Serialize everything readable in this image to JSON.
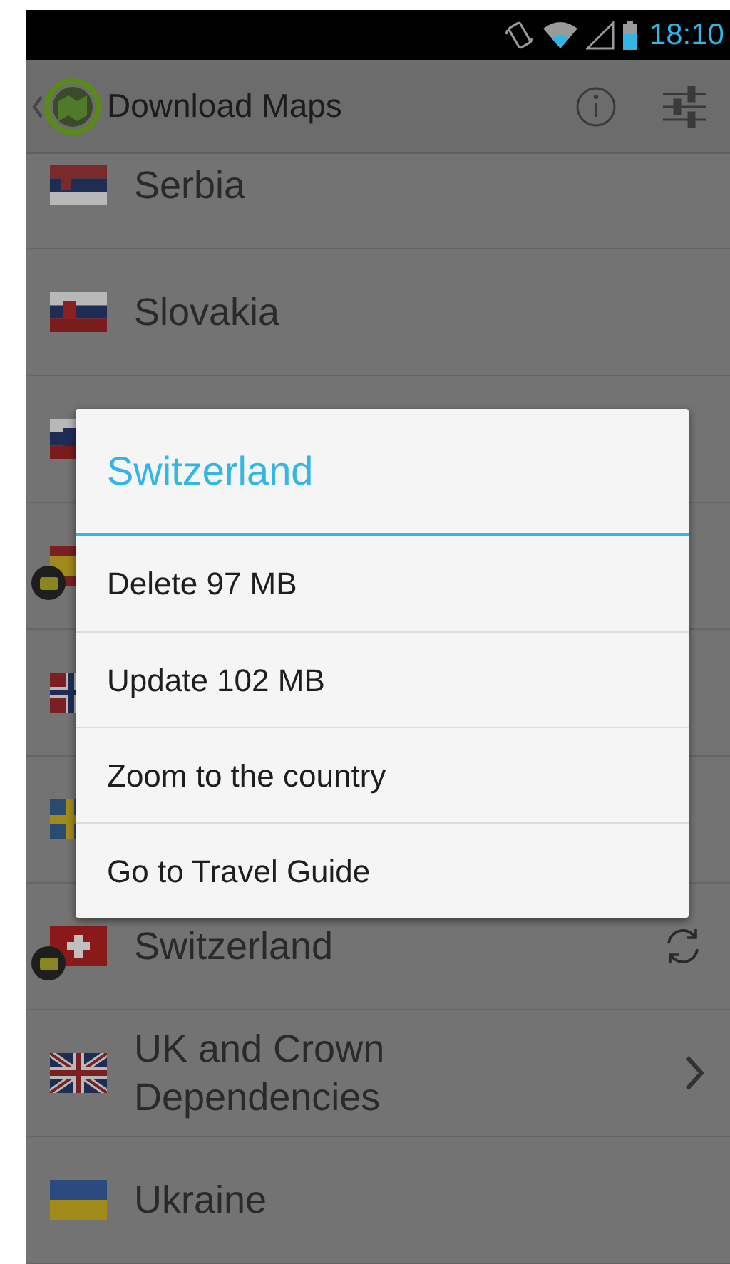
{
  "status_bar": {
    "time": "18:10"
  },
  "action_bar": {
    "title": "Download Maps"
  },
  "rows": [
    {
      "kind": "serbia",
      "name": "Serbia",
      "downloaded": false,
      "update_available": false,
      "has_children": false
    },
    {
      "kind": "slovakia",
      "name": "Slovakia",
      "downloaded": false,
      "update_available": false,
      "has_children": false
    },
    {
      "kind": "slovenia",
      "downloaded": false,
      "update_available": false,
      "has_children": false
    },
    {
      "kind": "spain",
      "downloaded": true,
      "update_available": false,
      "has_children": false
    },
    {
      "kind": "norway",
      "downloaded": false,
      "update_available": false,
      "has_children": false
    },
    {
      "kind": "sweden",
      "downloaded": false,
      "update_available": false,
      "has_children": false
    },
    {
      "kind": "switzerland",
      "name": "Switzerland",
      "downloaded": true,
      "update_available": true,
      "has_children": false
    },
    {
      "kind": "uk",
      "name": "UK and Crown Dependencies",
      "downloaded": false,
      "update_available": false,
      "has_children": true
    },
    {
      "kind": "ukraine",
      "name": "Ukraine",
      "downloaded": false,
      "update_available": false,
      "has_children": false
    }
  ],
  "dialog": {
    "title": "Switzerland",
    "items": [
      "Delete 97 MB",
      "Update 102 MB",
      "Zoom to the country",
      "Go to Travel Guide"
    ]
  }
}
